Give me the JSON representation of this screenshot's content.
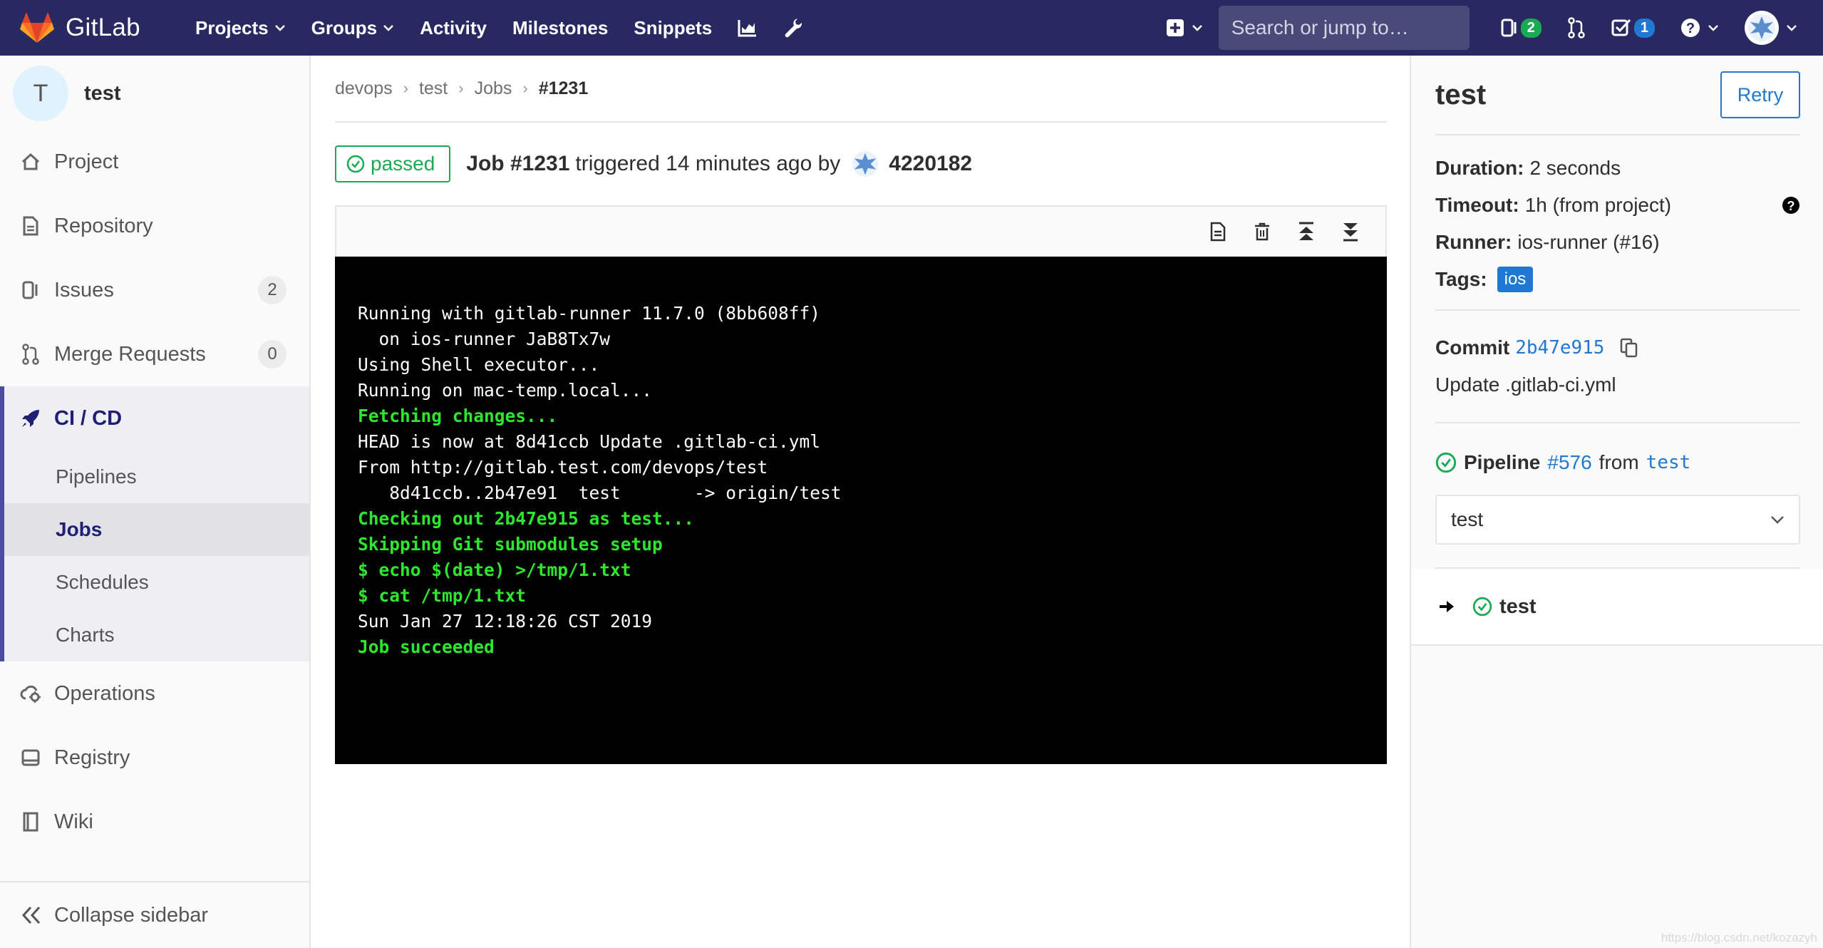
{
  "navbar": {
    "brand": "GitLab",
    "items": [
      {
        "label": "Projects",
        "has_caret": true
      },
      {
        "label": "Groups",
        "has_caret": true
      },
      {
        "label": "Activity",
        "has_caret": false
      },
      {
        "label": "Milestones",
        "has_caret": false
      },
      {
        "label": "Snippets",
        "has_caret": false
      }
    ],
    "search_placeholder": "Search or jump to…",
    "issues_count": "2",
    "todos_count": "1",
    "accent_color": "#292961"
  },
  "sidebar": {
    "project_initial": "T",
    "project_name": "test",
    "items": [
      {
        "label": "Project",
        "icon": "home-icon"
      },
      {
        "label": "Repository",
        "icon": "doc-icon"
      },
      {
        "label": "Issues",
        "icon": "issues-icon",
        "count": "2"
      },
      {
        "label": "Merge Requests",
        "icon": "merge-request-icon",
        "count": "0"
      }
    ],
    "ci": {
      "label": "CI / CD",
      "icon": "rocket-icon",
      "sub_items": [
        {
          "label": "Pipelines",
          "active": false
        },
        {
          "label": "Jobs",
          "active": true
        },
        {
          "label": "Schedules",
          "active": false
        },
        {
          "label": "Charts",
          "active": false
        }
      ]
    },
    "bottom_items": [
      {
        "label": "Operations",
        "icon": "cloud-gear-icon"
      },
      {
        "label": "Registry",
        "icon": "registry-icon"
      },
      {
        "label": "Wiki",
        "icon": "book-icon"
      }
    ],
    "collapse_label": "Collapse sidebar"
  },
  "breadcrumb": [
    "devops",
    "test",
    "Jobs",
    "#1231"
  ],
  "job": {
    "status": "passed",
    "title": "Job #1231",
    "triggered_text": "triggered 14 minutes ago by",
    "user": "4220182",
    "status_color": "#1aaa55"
  },
  "log": [
    {
      "text": "Running with gitlab-runner 11.7.0 (8bb608ff)",
      "style": "normal"
    },
    {
      "text": "  on ios-runner JaB8Tx7w",
      "style": "normal"
    },
    {
      "text": "Using Shell executor...",
      "style": "normal"
    },
    {
      "text": "Running on mac-temp.local...",
      "style": "normal"
    },
    {
      "text": "Fetching changes...",
      "style": "green"
    },
    {
      "text": "HEAD is now at 8d41ccb Update .gitlab-ci.yml",
      "style": "normal"
    },
    {
      "text": "From http://gitlab.test.com/devops/test",
      "style": "normal"
    },
    {
      "text": "   8d41ccb..2b47e91  test       -> origin/test",
      "style": "normal"
    },
    {
      "text": "Checking out 2b47e915 as test...",
      "style": "green"
    },
    {
      "text": "Skipping Git submodules setup",
      "style": "green"
    },
    {
      "text": "$ echo $(date) >/tmp/1.txt",
      "style": "green"
    },
    {
      "text": "$ cat /tmp/1.txt",
      "style": "green"
    },
    {
      "text": "Sun Jan 27 12:18:26 CST 2019",
      "style": "normal"
    },
    {
      "text": "Job succeeded",
      "style": "green"
    }
  ],
  "right": {
    "title": "test",
    "retry_label": "Retry",
    "duration_label": "Duration:",
    "duration": "2 seconds",
    "timeout_label": "Timeout:",
    "timeout": "1h (from project)",
    "runner_label": "Runner:",
    "runner": "ios-runner (#16)",
    "tags_label": "Tags:",
    "tag": "ios",
    "commit_label": "Commit",
    "commit_sha": "2b47e915",
    "commit_message": "Update .gitlab-ci.yml",
    "pipeline_label": "Pipeline",
    "pipeline_id": "#576",
    "pipeline_from": "from",
    "pipeline_ref": "test",
    "stage": "test",
    "job_name": "test"
  },
  "watermark": "https://blog.csdn.net/kozazyh"
}
